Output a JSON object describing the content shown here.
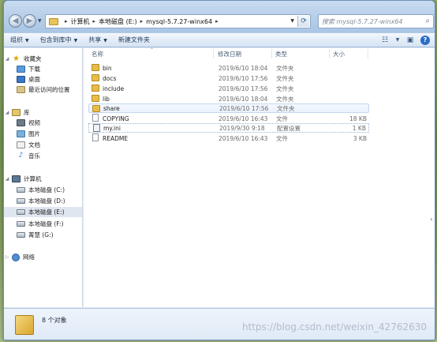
{
  "address": {
    "crumbs": [
      "计算机",
      "本地磁盘 (E:)",
      "mysql-5.7.27-winx64"
    ],
    "search_placeholder": "搜索 mysql-5.7.27-winx64"
  },
  "toolbar": {
    "organize": "组织",
    "include_in_library": "包含到库中",
    "share": "共享",
    "new_folder": "新建文件夹"
  },
  "nav": {
    "favorites": "收藏夹",
    "downloads": "下载",
    "desktop": "桌面",
    "recent": "最近访问的位置",
    "libraries": "库",
    "videos": "视频",
    "pictures": "图片",
    "documents": "文档",
    "music": "音乐",
    "computer": "计算机",
    "drive_c": "本地磁盘 (C:)",
    "drive_d": "本地磁盘 (D:)",
    "drive_e": "本地磁盘 (E:)",
    "drive_f": "本地磁盘 (F:)",
    "drive_g": "菁慧 (G:)",
    "network": "网络"
  },
  "columns": {
    "name": "名称",
    "date": "修改日期",
    "type": "类型",
    "size": "大小"
  },
  "files": [
    {
      "name": "bin",
      "date": "2019/6/10 18:04",
      "type": "文件夹",
      "size": ""
    },
    {
      "name": "docs",
      "date": "2019/6/10 17:56",
      "type": "文件夹",
      "size": ""
    },
    {
      "name": "include",
      "date": "2019/6/10 17:56",
      "type": "文件夹",
      "size": ""
    },
    {
      "name": "lib",
      "date": "2019/6/10 18:04",
      "type": "文件夹",
      "size": ""
    },
    {
      "name": "share",
      "date": "2019/6/10 17:56",
      "type": "文件夹",
      "size": ""
    },
    {
      "name": "COPYING",
      "date": "2019/6/10 16:43",
      "type": "文件",
      "size": "18 KB"
    },
    {
      "name": "my.ini",
      "date": "2019/9/30 9:18",
      "type": "配置设置",
      "size": "1 KB"
    },
    {
      "name": "README",
      "date": "2019/6/10 16:43",
      "type": "文件",
      "size": "3 KB"
    }
  ],
  "status": {
    "count": "8 个对象",
    "watermark": "https://blog.csdn.net/weixin_42762630"
  }
}
